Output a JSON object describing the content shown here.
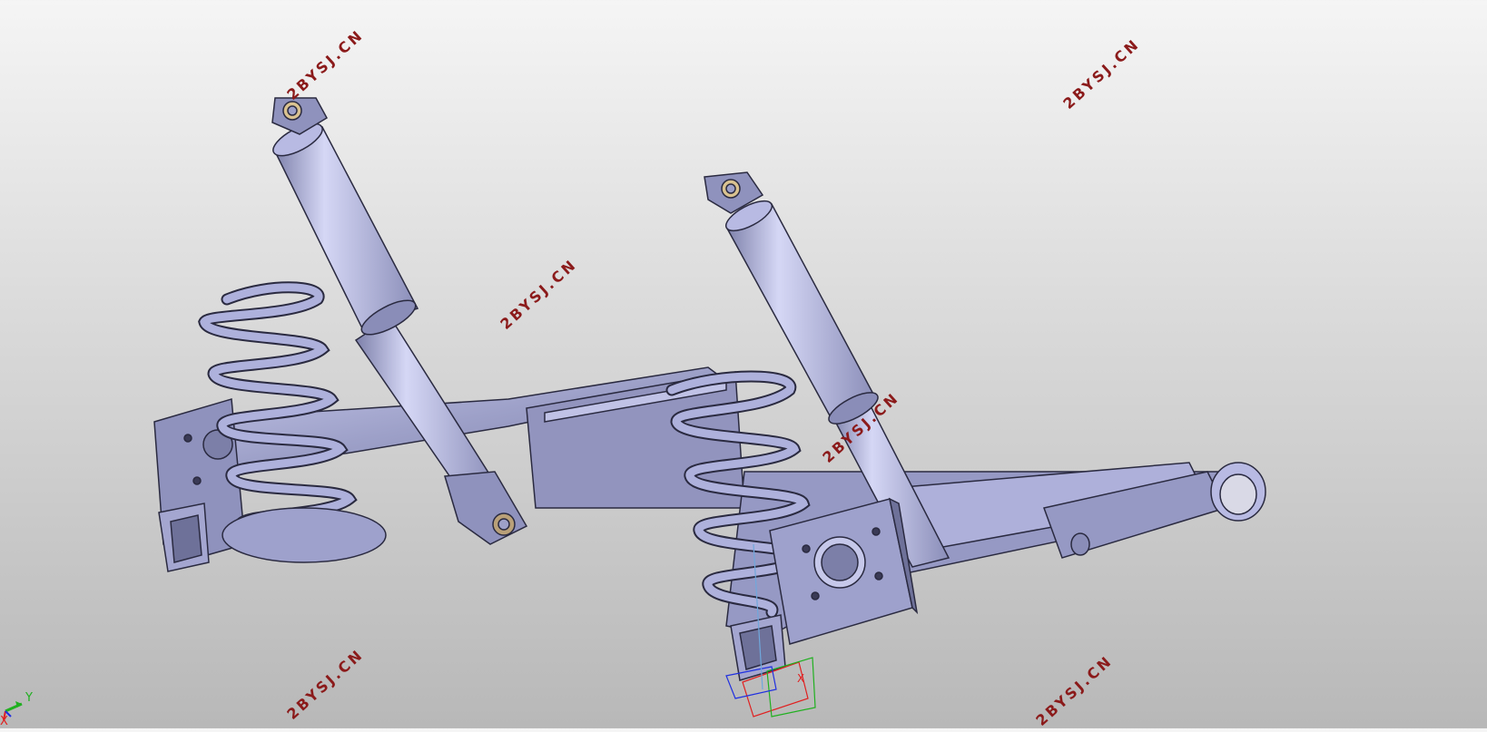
{
  "viewport": {
    "background_top": "#f5f5f5",
    "background_bottom": "#b8b8b8",
    "part_fill": "#9da0c8",
    "part_edge": "#2a2a40"
  },
  "watermarks": [
    "2BYSJ.CN",
    "2BYSJ.CN",
    "2BYSJ.CN",
    "2BYSJ.CN",
    "2BYSJ.CN",
    "2BYSJ.CN",
    "2BYSJ.CN"
  ],
  "axis_triad": {
    "y_label": "Y",
    "x_label": "X",
    "colors": {
      "x": "#e02020",
      "y": "#20b020",
      "z": "#2030e0"
    }
  },
  "part_triad": {
    "x_label": "X"
  }
}
